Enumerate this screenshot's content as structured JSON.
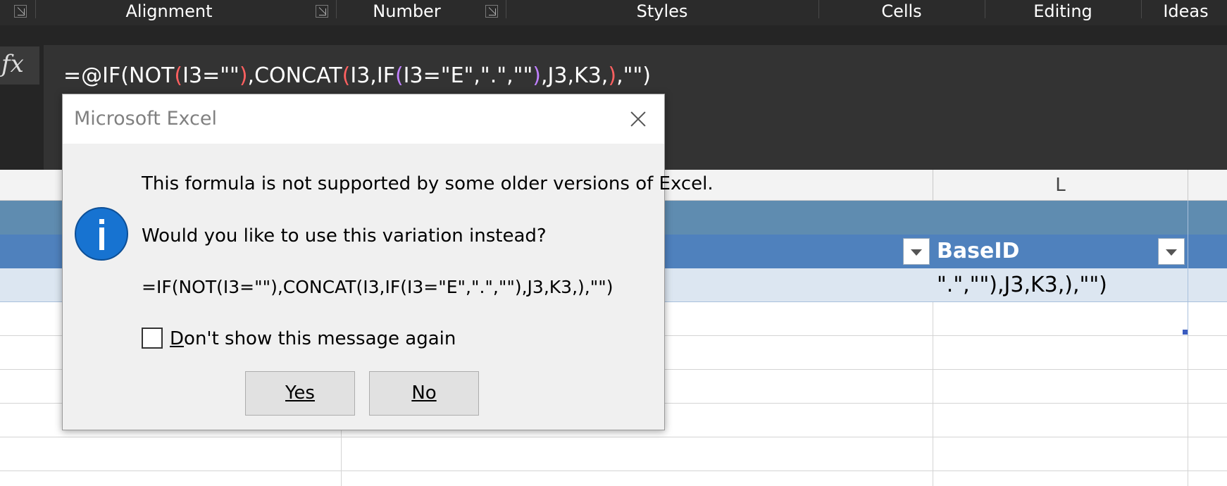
{
  "ribbon": {
    "groups": [
      "Alignment",
      "Number",
      "Styles",
      "Cells",
      "Editing",
      "Ideas"
    ]
  },
  "formula_bar": {
    "fx_label": "fx",
    "formula": "=@IF(NOT(I3=\"\"),CONCAT(I3,IF(I3=\"E\",\".\",\"\"),J3,K3,),\"\")"
  },
  "sheet": {
    "column_L_header": "L",
    "table_header_L": "BaseID",
    "cell_L3_text": "\".\",\"\"),J3,K3,),\"\")"
  },
  "dialog": {
    "title": "Microsoft Excel",
    "message_line1": "This formula is not supported by some older versions of Excel.",
    "message_line2": "Would you like to use this variation instead?",
    "suggested_formula": "=IF(NOT(I3=\"\"),CONCAT(I3,IF(I3=\"E\",\".\",\"\"),J3,K3,),\"\")",
    "checkbox_label_first": "D",
    "checkbox_label_rest": "on't show this message again",
    "checkbox_checked": false,
    "yes_label": "Yes",
    "no_label": "No",
    "icon": "info-icon"
  },
  "colors": {
    "ribbon_bg": "#2b2b2b",
    "table_header_bg": "#4f81bd",
    "table_band_bg": "#5f8cb0",
    "data_row_bg": "#dce6f1",
    "info_icon": "#1773d1"
  }
}
